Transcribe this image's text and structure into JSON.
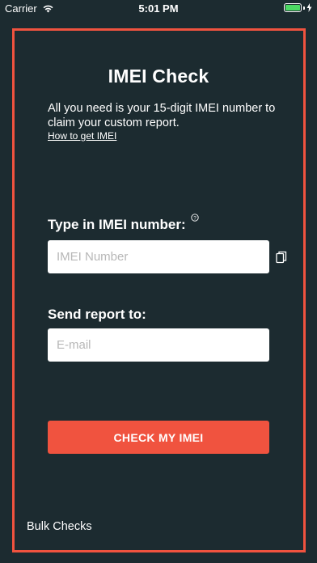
{
  "status_bar": {
    "carrier": "Carrier",
    "time": "5:01 PM",
    "icons": [
      "wifi-icon",
      "battery-icon",
      "charging-icon"
    ]
  },
  "colors": {
    "background": "#1c2b30",
    "accent": "#f0533f",
    "battery": "#4cd964"
  },
  "main": {
    "title": "IMEI Check",
    "intro": "All you need is your 15-digit IMEI number to claim your custom report.",
    "help_link": "How to get IMEI",
    "imei_label": "Type in IMEI number:",
    "imei_placeholder": "IMEI Number",
    "imei_value": "",
    "email_label": "Send report to:",
    "email_placeholder": "E-mail",
    "email_value": "",
    "check_button": "CHECK MY IMEI",
    "bulk_link": "Bulk Checks"
  }
}
